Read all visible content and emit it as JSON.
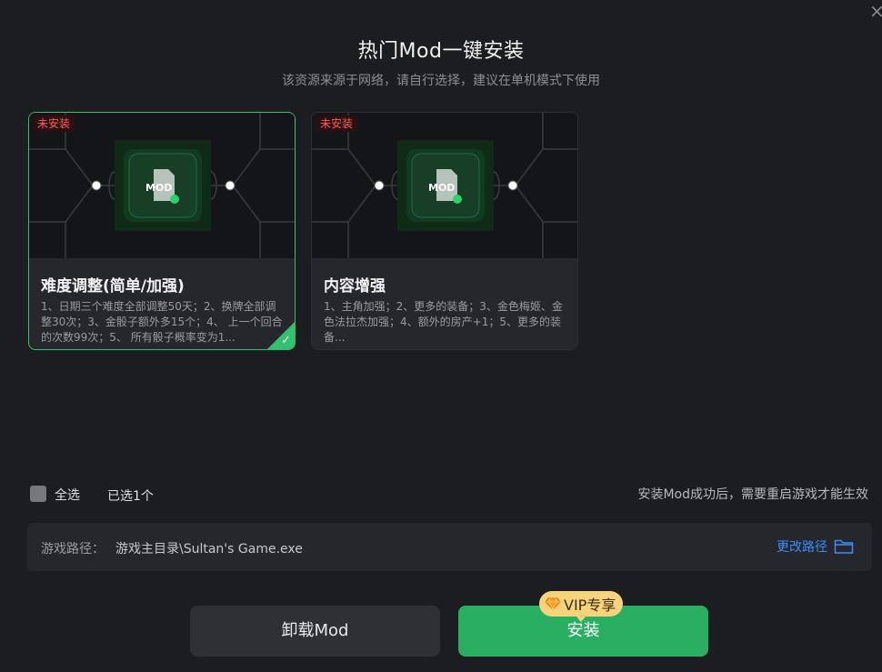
{
  "dialog": {
    "title": "热门Mod一键安装",
    "subtitle": "该资源来源于网络，请自行选择，建议在单机模式下使用"
  },
  "mods": [
    {
      "badge": "未安装",
      "title": "难度调整(简单/加强)",
      "description": "1、日期三个难度全部调整50天；2、换牌全部调整30次；3、金骰子额外多15个；4、 上一个回合的次数99次；5、 所有骰子概率变为1...",
      "selected": true,
      "icon": "mod-wrench-icon"
    },
    {
      "badge": "未安装",
      "title": "内容增强",
      "description": "1、主角加强；2、更多的装备；3、金色梅姬、金色法拉杰加强；4、额外的房产+1；5、更多的装备...",
      "selected": false,
      "icon": "mod-wrench-icon"
    }
  ],
  "selection": {
    "select_all_label": "全选",
    "selected_count": "已选1个",
    "restart_hint": "安装Mod成功后，需要重启游戏才能生效"
  },
  "path": {
    "label": "游戏路径：",
    "value": "游戏主目录\\Sultan's Game.exe",
    "change_label": "更改路径"
  },
  "buttons": {
    "uninstall": "卸载Mod",
    "install": "安装",
    "vip_badge": "VIP专享"
  },
  "colors": {
    "accent_green": "#33c26b",
    "install_green": "#2aae62",
    "link_blue": "#3a8dfc",
    "badge_red": "#ff5a5a",
    "vip_gold": "#f7d37b"
  }
}
